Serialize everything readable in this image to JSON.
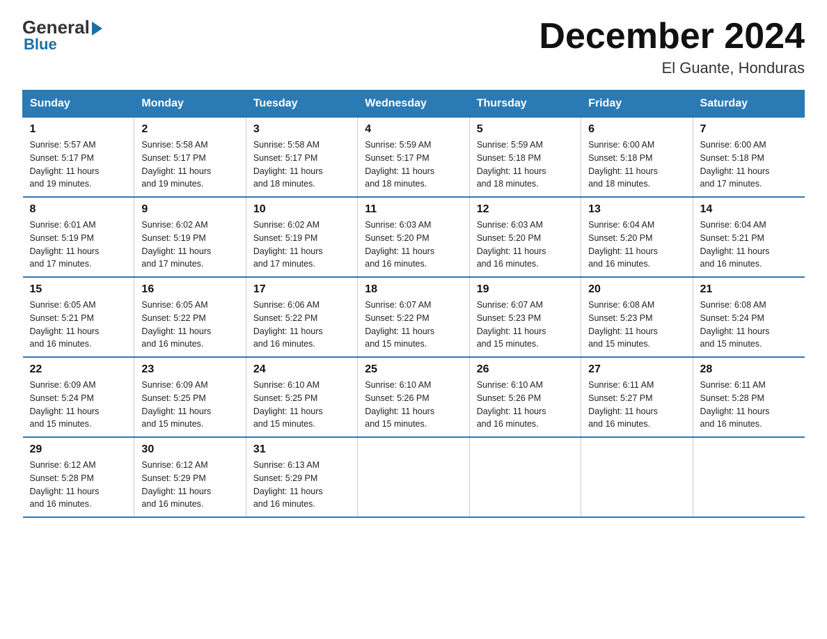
{
  "header": {
    "logo_general": "General",
    "logo_blue": "Blue",
    "title": "December 2024",
    "subtitle": "El Guante, Honduras"
  },
  "days_of_week": [
    "Sunday",
    "Monday",
    "Tuesday",
    "Wednesday",
    "Thursday",
    "Friday",
    "Saturday"
  ],
  "weeks": [
    [
      {
        "day": "1",
        "info": "Sunrise: 5:57 AM\nSunset: 5:17 PM\nDaylight: 11 hours\nand 19 minutes."
      },
      {
        "day": "2",
        "info": "Sunrise: 5:58 AM\nSunset: 5:17 PM\nDaylight: 11 hours\nand 19 minutes."
      },
      {
        "day": "3",
        "info": "Sunrise: 5:58 AM\nSunset: 5:17 PM\nDaylight: 11 hours\nand 18 minutes."
      },
      {
        "day": "4",
        "info": "Sunrise: 5:59 AM\nSunset: 5:17 PM\nDaylight: 11 hours\nand 18 minutes."
      },
      {
        "day": "5",
        "info": "Sunrise: 5:59 AM\nSunset: 5:18 PM\nDaylight: 11 hours\nand 18 minutes."
      },
      {
        "day": "6",
        "info": "Sunrise: 6:00 AM\nSunset: 5:18 PM\nDaylight: 11 hours\nand 18 minutes."
      },
      {
        "day": "7",
        "info": "Sunrise: 6:00 AM\nSunset: 5:18 PM\nDaylight: 11 hours\nand 17 minutes."
      }
    ],
    [
      {
        "day": "8",
        "info": "Sunrise: 6:01 AM\nSunset: 5:19 PM\nDaylight: 11 hours\nand 17 minutes."
      },
      {
        "day": "9",
        "info": "Sunrise: 6:02 AM\nSunset: 5:19 PM\nDaylight: 11 hours\nand 17 minutes."
      },
      {
        "day": "10",
        "info": "Sunrise: 6:02 AM\nSunset: 5:19 PM\nDaylight: 11 hours\nand 17 minutes."
      },
      {
        "day": "11",
        "info": "Sunrise: 6:03 AM\nSunset: 5:20 PM\nDaylight: 11 hours\nand 16 minutes."
      },
      {
        "day": "12",
        "info": "Sunrise: 6:03 AM\nSunset: 5:20 PM\nDaylight: 11 hours\nand 16 minutes."
      },
      {
        "day": "13",
        "info": "Sunrise: 6:04 AM\nSunset: 5:20 PM\nDaylight: 11 hours\nand 16 minutes."
      },
      {
        "day": "14",
        "info": "Sunrise: 6:04 AM\nSunset: 5:21 PM\nDaylight: 11 hours\nand 16 minutes."
      }
    ],
    [
      {
        "day": "15",
        "info": "Sunrise: 6:05 AM\nSunset: 5:21 PM\nDaylight: 11 hours\nand 16 minutes."
      },
      {
        "day": "16",
        "info": "Sunrise: 6:05 AM\nSunset: 5:22 PM\nDaylight: 11 hours\nand 16 minutes."
      },
      {
        "day": "17",
        "info": "Sunrise: 6:06 AM\nSunset: 5:22 PM\nDaylight: 11 hours\nand 16 minutes."
      },
      {
        "day": "18",
        "info": "Sunrise: 6:07 AM\nSunset: 5:22 PM\nDaylight: 11 hours\nand 15 minutes."
      },
      {
        "day": "19",
        "info": "Sunrise: 6:07 AM\nSunset: 5:23 PM\nDaylight: 11 hours\nand 15 minutes."
      },
      {
        "day": "20",
        "info": "Sunrise: 6:08 AM\nSunset: 5:23 PM\nDaylight: 11 hours\nand 15 minutes."
      },
      {
        "day": "21",
        "info": "Sunrise: 6:08 AM\nSunset: 5:24 PM\nDaylight: 11 hours\nand 15 minutes."
      }
    ],
    [
      {
        "day": "22",
        "info": "Sunrise: 6:09 AM\nSunset: 5:24 PM\nDaylight: 11 hours\nand 15 minutes."
      },
      {
        "day": "23",
        "info": "Sunrise: 6:09 AM\nSunset: 5:25 PM\nDaylight: 11 hours\nand 15 minutes."
      },
      {
        "day": "24",
        "info": "Sunrise: 6:10 AM\nSunset: 5:25 PM\nDaylight: 11 hours\nand 15 minutes."
      },
      {
        "day": "25",
        "info": "Sunrise: 6:10 AM\nSunset: 5:26 PM\nDaylight: 11 hours\nand 15 minutes."
      },
      {
        "day": "26",
        "info": "Sunrise: 6:10 AM\nSunset: 5:26 PM\nDaylight: 11 hours\nand 16 minutes."
      },
      {
        "day": "27",
        "info": "Sunrise: 6:11 AM\nSunset: 5:27 PM\nDaylight: 11 hours\nand 16 minutes."
      },
      {
        "day": "28",
        "info": "Sunrise: 6:11 AM\nSunset: 5:28 PM\nDaylight: 11 hours\nand 16 minutes."
      }
    ],
    [
      {
        "day": "29",
        "info": "Sunrise: 6:12 AM\nSunset: 5:28 PM\nDaylight: 11 hours\nand 16 minutes."
      },
      {
        "day": "30",
        "info": "Sunrise: 6:12 AM\nSunset: 5:29 PM\nDaylight: 11 hours\nand 16 minutes."
      },
      {
        "day": "31",
        "info": "Sunrise: 6:13 AM\nSunset: 5:29 PM\nDaylight: 11 hours\nand 16 minutes."
      },
      {
        "day": "",
        "info": ""
      },
      {
        "day": "",
        "info": ""
      },
      {
        "day": "",
        "info": ""
      },
      {
        "day": "",
        "info": ""
      }
    ]
  ]
}
